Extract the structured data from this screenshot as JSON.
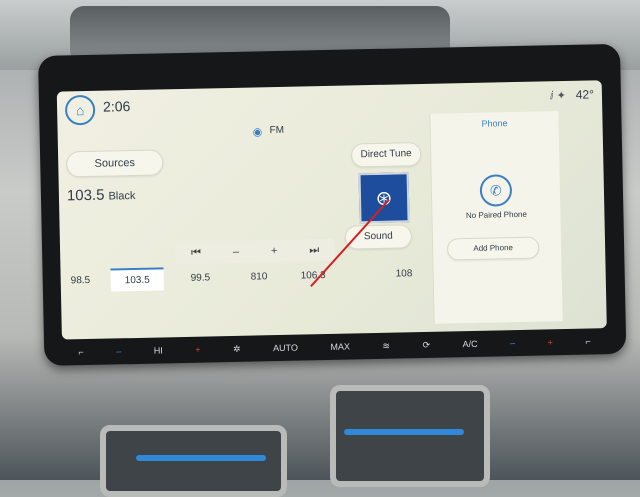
{
  "header": {
    "home_icon": "home-icon",
    "clock": "2:06",
    "temperature": "42°"
  },
  "source": {
    "icon": "radio-signal-icon",
    "label": "FM"
  },
  "main": {
    "sources_label": "Sources",
    "station_frequency": "103.5",
    "station_name": "Black",
    "direct_tune_label": "Direct Tune",
    "sound_label": "Sound",
    "controls": [
      "⏮",
      "–",
      "+",
      "⏭"
    ]
  },
  "presets": [
    {
      "label": "98.5"
    },
    {
      "label": "103.5",
      "active": true
    },
    {
      "label": "99.5"
    },
    {
      "label": "810"
    },
    {
      "label": "106.3"
    },
    {
      "label": "108"
    }
  ],
  "phone": {
    "title": "Phone",
    "status": "No Paired Phone",
    "add_label": "Add Phone"
  },
  "hvac": {
    "hi_label": "HI",
    "auto_label": "AUTO",
    "max_label": "MAX",
    "ac_label": "A/C"
  },
  "colors": {
    "accent": "#3a7fc4",
    "annotation_line": "#d62020"
  }
}
